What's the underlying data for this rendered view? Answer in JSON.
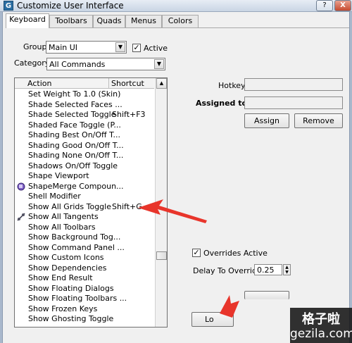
{
  "window": {
    "title": "Customize User Interface",
    "help_label": "?",
    "close_label": "X",
    "title_icon": "G"
  },
  "tabs": [
    {
      "label": "Keyboard",
      "active": true
    },
    {
      "label": "Toolbars",
      "active": false
    },
    {
      "label": "Quads",
      "active": false
    },
    {
      "label": "Menus",
      "active": false
    },
    {
      "label": "Colors",
      "active": false
    }
  ],
  "group": {
    "label": "Group:",
    "value": "Main UI",
    "active_label": "Active",
    "active_checked": true
  },
  "category": {
    "label": "Category:",
    "value": "All Commands"
  },
  "action_list": {
    "columns": [
      "Action",
      "Shortcut"
    ],
    "rows": [
      {
        "action": "Set Weight To 1.0 (Skin)",
        "shortcut": ""
      },
      {
        "action": "Shade Selected Faces ...",
        "shortcut": ""
      },
      {
        "action": "Shade Selected Toggle",
        "shortcut": "Shift+F3"
      },
      {
        "action": "Shaded Face Toggle (P...",
        "shortcut": ""
      },
      {
        "action": "Shading Best On/Off T...",
        "shortcut": ""
      },
      {
        "action": "Shading Good On/Off T...",
        "shortcut": ""
      },
      {
        "action": "Shading None On/Off T...",
        "shortcut": ""
      },
      {
        "action": "Shadows On/Off Toggle",
        "shortcut": ""
      },
      {
        "action": "Shape Viewport",
        "shortcut": ""
      },
      {
        "action": "ShapeMerge Compoun...",
        "shortcut": "",
        "icon": "shapemerge-icon"
      },
      {
        "action": "Shell Modifier",
        "shortcut": ""
      },
      {
        "action": "Show All Grids Toggle",
        "shortcut": "Shift+G"
      },
      {
        "action": "Show All Tangents",
        "shortcut": "",
        "icon": "tangents-icon"
      },
      {
        "action": "Show All Toolbars",
        "shortcut": ""
      },
      {
        "action": "Show Background Tog...",
        "shortcut": ""
      },
      {
        "action": "Show Command Panel ...",
        "shortcut": ""
      },
      {
        "action": "Show Custom Icons",
        "shortcut": ""
      },
      {
        "action": "Show Dependencies",
        "shortcut": ""
      },
      {
        "action": "Show End Result",
        "shortcut": ""
      },
      {
        "action": "Show Floating Dialogs",
        "shortcut": ""
      },
      {
        "action": "Show Floating Toolbars ...",
        "shortcut": ""
      },
      {
        "action": "Show Frozen Keys",
        "shortcut": ""
      },
      {
        "action": "Show Ghosting Toggle",
        "shortcut": ""
      }
    ]
  },
  "hotkey": {
    "label": "Hotkey:",
    "value": ""
  },
  "assigned_to": {
    "label": "Assigned to:",
    "value": ""
  },
  "buttons": {
    "assign": "Assign",
    "remove": "Remove",
    "load_partial": "Lo"
  },
  "overrides": {
    "label": "Overrides Active",
    "checked": true
  },
  "delay": {
    "label": "Delay To Override:",
    "value": "0.25"
  },
  "watermark": {
    "line1": "格子啦",
    "line2": "gezila.com"
  },
  "colors": {
    "annotation_arrow": "#e8352b"
  }
}
